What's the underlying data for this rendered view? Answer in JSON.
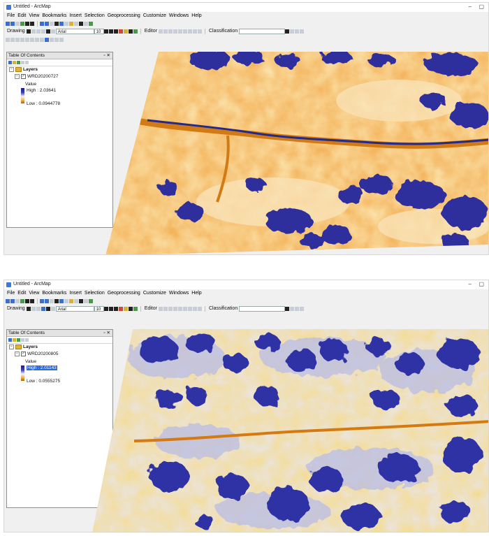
{
  "windows": [
    {
      "title": "Untitled - ArcMap",
      "menu": [
        "File",
        "Edit",
        "View",
        "Bookmarks",
        "Insert",
        "Selection",
        "Geoprocessing",
        "Customize",
        "Windows",
        "Help"
      ],
      "toolbar": {
        "drawing_label": "Drawing",
        "font_name": "Arial",
        "font_size": "10",
        "editor_label": "Editor",
        "classification_label": "Classification"
      },
      "toc": {
        "title": "Table Of Contents",
        "layers_label": "Layers",
        "layer_name": "WRD20200727",
        "value_label": "Value",
        "high_label": "High : 2.03641",
        "low_label": "Low : 0.0944778"
      },
      "colors": {
        "high": "#1f1f8f",
        "mid": "#f2f2f2",
        "low": "#c86b00"
      }
    },
    {
      "title": "Untitled - ArcMap",
      "menu": [
        "File",
        "Edit",
        "View",
        "Bookmarks",
        "Insert",
        "Selection",
        "Geoprocessing",
        "Customize",
        "Windows",
        "Help"
      ],
      "toolbar": {
        "drawing_label": "Drawing",
        "font_name": "Arial",
        "font_size": "10",
        "editor_label": "Editor",
        "classification_label": "Classification"
      },
      "toc": {
        "title": "Table Of Contents",
        "layers_label": "Layers",
        "layer_name": "WRD20200805",
        "value_label": "Value",
        "high_label": "High : 2.01143",
        "low_label": "Low : 0.0555275"
      },
      "colors": {
        "high": "#1f1f8f",
        "mid": "#f2f2f2",
        "low": "#c86b00"
      }
    }
  ]
}
